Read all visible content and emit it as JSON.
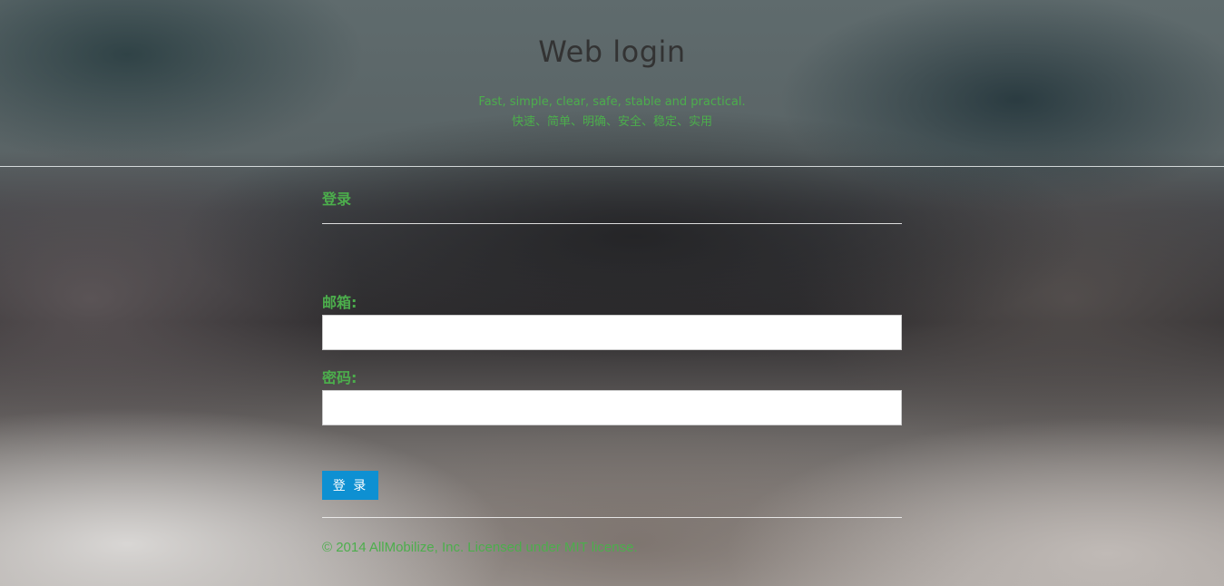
{
  "header": {
    "title": "Web login",
    "tagline_en": "Fast, simple, clear, safe, stable and practical.",
    "tagline_zh": "快速、简单、明确、安全、稳定、实用"
  },
  "form": {
    "section_title": "登录",
    "email_label": "邮箱:",
    "email_value": "",
    "password_label": "密码:",
    "password_value": "",
    "submit_label": "登 录"
  },
  "footer": {
    "text": "© 2014 AllMobilize, Inc. Licensed under MIT license."
  },
  "colors": {
    "accent_green": "#4cae4c",
    "button_blue": "#0e90d2",
    "title_text": "#333333"
  }
}
